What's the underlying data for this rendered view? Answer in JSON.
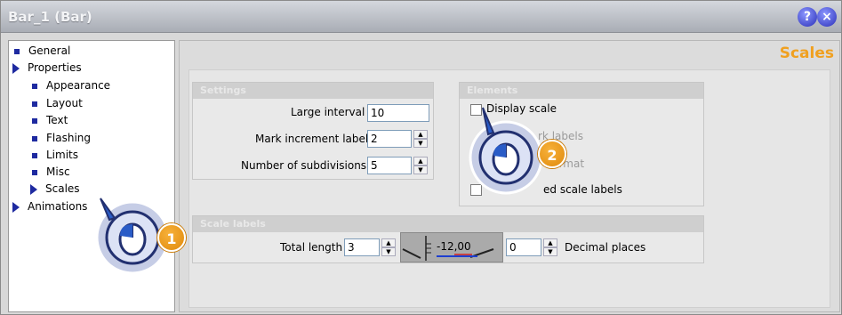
{
  "window": {
    "title": "Bar_1 (Bar)",
    "help_icon": "help-icon",
    "close_icon": "close-icon"
  },
  "nav": {
    "items": [
      {
        "label": "General",
        "icon": "bullet"
      },
      {
        "label": "Properties",
        "icon": "expand-arrow"
      },
      {
        "label": "Appearance",
        "icon": "bullet"
      },
      {
        "label": "Layout",
        "icon": "bullet"
      },
      {
        "label": "Text",
        "icon": "bullet"
      },
      {
        "label": "Flashing",
        "icon": "bullet"
      },
      {
        "label": "Limits",
        "icon": "bullet"
      },
      {
        "label": "Misc",
        "icon": "bullet"
      },
      {
        "label": "Scales",
        "icon": "selected-arrow"
      },
      {
        "label": "Animations",
        "icon": "expand-arrow"
      }
    ]
  },
  "page": {
    "title": "Scales"
  },
  "settings": {
    "group_title": "Settings",
    "large_interval": {
      "label": "Large interval",
      "value": "10"
    },
    "mark_increment": {
      "label": "Mark increment label",
      "value": "2"
    },
    "subdivisions": {
      "label": "Number of subdivisions",
      "value": "5"
    }
  },
  "elements": {
    "group_title": "Elements",
    "display_scale": "Display scale",
    "mark_labels": "rk labels",
    "format": "format",
    "scale_labels": "ed scale labels"
  },
  "scale_labels": {
    "group_title": "Scale labels",
    "total_length_label": "Total length",
    "total_length_value": "3",
    "preview_value": "-12,00",
    "decimal_places_value": "0",
    "decimal_places_label": "Decimal places"
  },
  "callouts": [
    {
      "number": "1"
    },
    {
      "number": "2"
    }
  ],
  "colors": {
    "accent": "#f0a020",
    "nav_bullet": "#1e2aa0",
    "callout": "#f29a17"
  }
}
